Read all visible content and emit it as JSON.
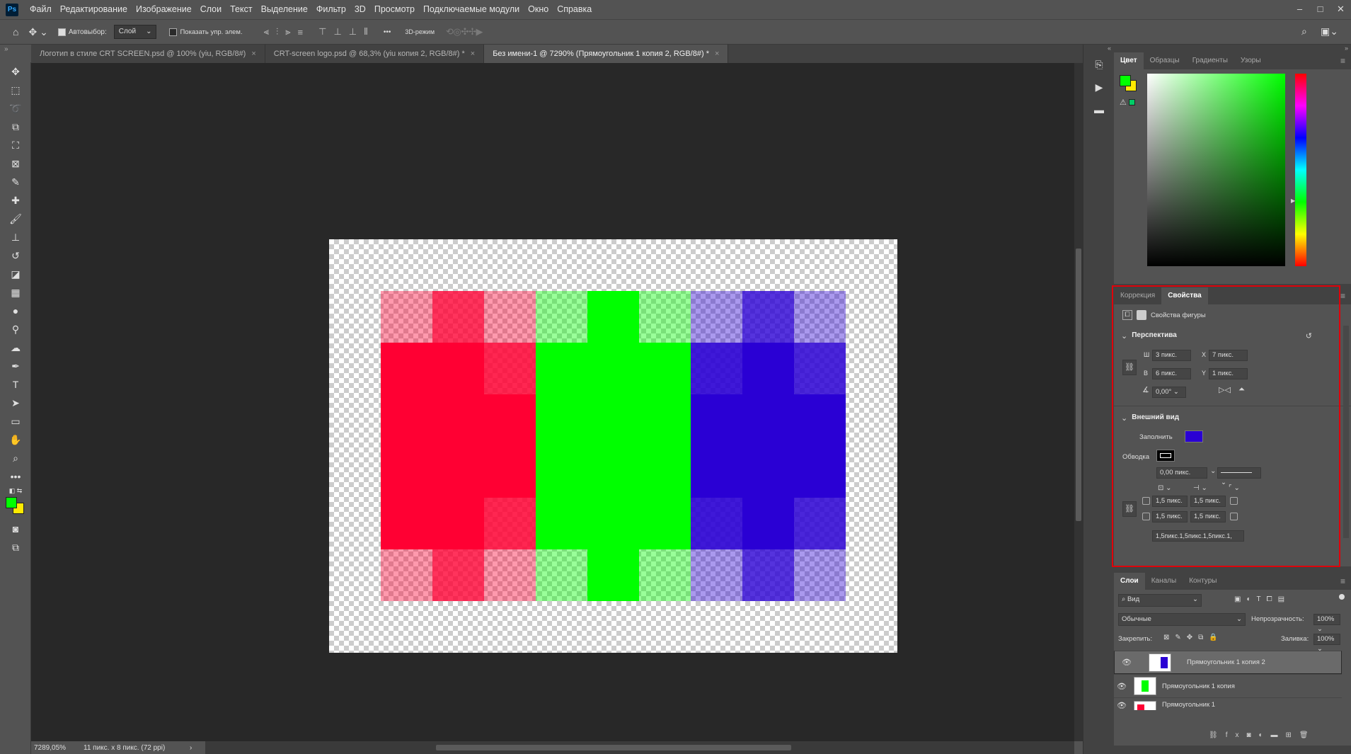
{
  "app": {
    "logo": "Ps"
  },
  "menu": [
    "Файл",
    "Редактирование",
    "Изображение",
    "Слои",
    "Текст",
    "Выделение",
    "Фильтр",
    "3D",
    "Просмотр",
    "Подключаемые модули",
    "Окно",
    "Справка"
  ],
  "window_controls": {
    "minimize": "–",
    "maximize": "□",
    "close": "✕"
  },
  "options": {
    "autoselect_label": "Автовыбор:",
    "autoselect_value": "Слой",
    "show_transform": "Показать упр. элем.",
    "mode3d": "3D-режим",
    "more": "•••"
  },
  "tabs": [
    {
      "label": "Логотип в стиле CRT SCREEN.psd @ 100% (yiu, RGB/8#)"
    },
    {
      "label": "CRT-screen logo.psd @ 68,3% (yiu копия 2, RGB/8#) *"
    },
    {
      "label": "Без имени-1 @ 7290% (Прямоугольник 1 копия 2, RGB/8#) *"
    }
  ],
  "status": {
    "zoom": "7289,05%",
    "docinfo": "11 пикс. x 8 пикс. (72 ppi)",
    "arrow": "›"
  },
  "color_panel": {
    "tabs": [
      "Цвет",
      "Образцы",
      "Градиенты",
      "Узоры"
    ],
    "foreground": "#00ff00",
    "background": "#ffea00"
  },
  "properties_panel": {
    "tabs": [
      "Коррекция",
      "Свойства"
    ],
    "shape_title": "Свойства фигуры",
    "perspective": {
      "title": "Перспектива",
      "w_label": "Ш",
      "w": "3 пикс.",
      "h_label": "В",
      "h": "6 пикс.",
      "x_label": "X",
      "x": "7 пикс.",
      "y_label": "Y",
      "y": "1 пикс.",
      "angle": "0,00°"
    },
    "appearance": {
      "title": "Внешний вид",
      "fill_label": "Заполнить",
      "fill_color": "#2a00d4",
      "stroke_label": "Обводка",
      "stroke_width": "0,00 пикс.",
      "corners": [
        "1,5 пикс.",
        "1,5 пикс.",
        "1,5 пикс.",
        "1,5 пикс."
      ],
      "corners_summary": "1,5пикс.1,5пикс.1,5пикс.1,"
    }
  },
  "layers_panel": {
    "tabs": [
      "Слои",
      "Каналы",
      "Контуры"
    ],
    "filter": "Вид",
    "blend": "Обычные",
    "opacity_label": "Непрозрачность:",
    "opacity": "100%",
    "lock_label": "Закрепить:",
    "fill_label": "Заливка:",
    "fill": "100%",
    "layers": [
      {
        "name": "Прямоугольник 1 копия 2",
        "selected": true,
        "color": "#2a00d4"
      },
      {
        "name": "Прямоугольник 1 копия",
        "selected": false,
        "color": "#00ff00"
      },
      {
        "name": "Прямоугольник 1",
        "selected": false,
        "color": "#ff0033"
      }
    ]
  }
}
